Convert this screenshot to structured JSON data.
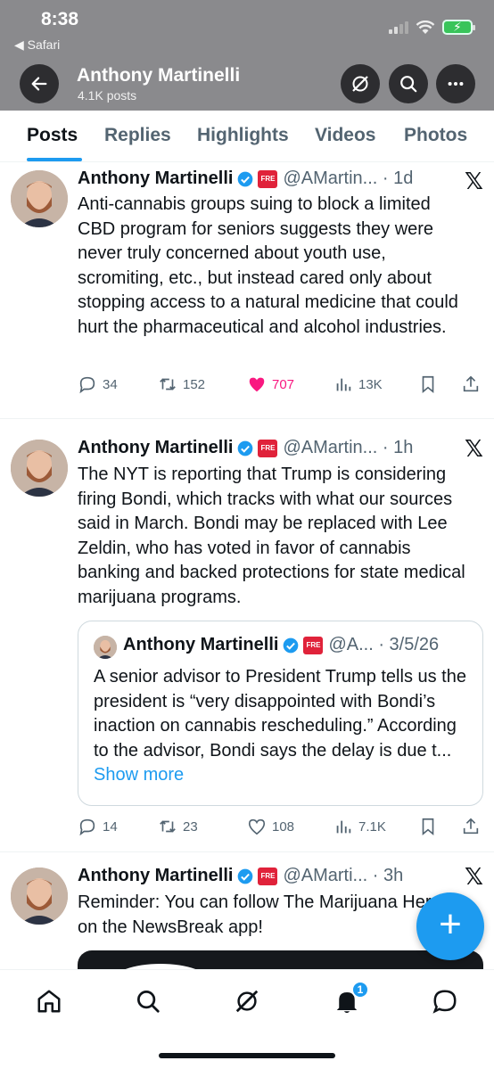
{
  "status_bar": {
    "time": "8:38",
    "back_app": "◀ Safari"
  },
  "header": {
    "name": "Anthony Martinelli",
    "posts_count": "4.1K posts"
  },
  "tabs": [
    "Posts",
    "Replies",
    "Highlights",
    "Videos",
    "Photos"
  ],
  "active_tab": "Posts",
  "colors": {
    "accent": "#1d9bf0",
    "like": "#f91880",
    "header_overlay": "#8a8a8d",
    "verified": "#1d9bf0",
    "org_badge": "#e0223a"
  },
  "posts": [
    {
      "name": "Anthony Martinelli",
      "handle_time": "@AMartin... · 1d",
      "text": "Anti-cannabis groups suing to block a limited CBD program for seniors suggests they were never truly concerned about youth use, scromiting, etc., but instead cared only about stopping access to a natural medicine that could hurt the pharmaceutical and alcohol industries.",
      "replies": "34",
      "reposts": "152",
      "likes": "707",
      "views": "13K",
      "liked": true
    },
    {
      "name": "Anthony Martinelli",
      "handle_time": "@AMartin... · 1h",
      "text": "The NYT is reporting that Trump is considering firing Bondi, which tracks with what our sources said in March. Bondi may be replaced with Lee Zeldin, who has voted in favor of cannabis banking and backed protections for state medical marijuana programs.",
      "quote": {
        "name": "Anthony Martinelli",
        "handle_time": "@A... · 3/5/26",
        "text": "A senior advisor to President Trump tells us the president is “very disappointed with Bondi’s inaction on cannabis rescheduling.” According to the advisor, Bondi says the delay is due t...",
        "show_more": "Show more"
      },
      "replies": "14",
      "reposts": "23",
      "likes": "108",
      "views": "7.1K",
      "liked": false
    },
    {
      "name": "Anthony Martinelli",
      "handle_time": "@AMarti... · 3h",
      "text_line1": "Reminder: You can follow The Marijuana Herald",
      "text_line2": "on the NewsBreak app!"
    }
  ],
  "bottom_nav": {
    "notification_count": "1"
  },
  "icons": [
    "back-arrow-icon",
    "grok-icon",
    "search-icon",
    "more-icon",
    "verified-icon",
    "x-logo-icon",
    "reply-icon",
    "repost-icon",
    "like-icon",
    "views-icon",
    "bookmark-icon",
    "share-icon",
    "home-icon",
    "bell-icon",
    "messages-icon",
    "plus-icon"
  ]
}
